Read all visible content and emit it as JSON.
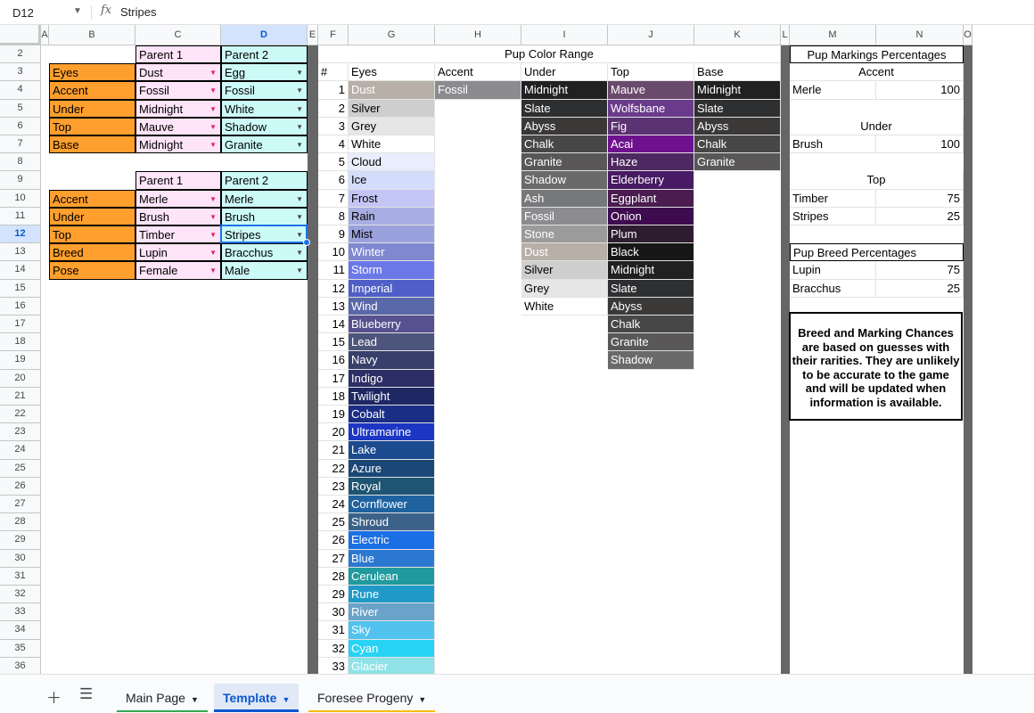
{
  "formula_bar": {
    "cell_ref": "D12",
    "fx": "fx",
    "content": "Stripes"
  },
  "columns": [
    "A",
    "B",
    "C",
    "D",
    "E",
    "F",
    "G",
    "H",
    "I",
    "J",
    "K",
    "L",
    "M",
    "N",
    "O"
  ],
  "rows": [
    "2",
    "3",
    "4",
    "5",
    "6",
    "7",
    "8",
    "9",
    "10",
    "11",
    "12",
    "13",
    "14",
    "15",
    "16",
    "17",
    "18",
    "19",
    "20",
    "21",
    "22",
    "23",
    "24",
    "25",
    "26",
    "27",
    "28",
    "29",
    "30",
    "31",
    "32",
    "33",
    "34",
    "35",
    "36"
  ],
  "selected": {
    "col": "D",
    "row": "12"
  },
  "parents_table": {
    "parent1_header": "Parent 1",
    "parent2_header": "Parent 2",
    "colors": [
      {
        "label": "Eyes",
        "p1": "Dust",
        "p2": "Egg"
      },
      {
        "label": "Accent",
        "p1": "Fossil",
        "p2": "Fossil"
      },
      {
        "label": "Under",
        "p1": "Midnight",
        "p2": "White"
      },
      {
        "label": "Top",
        "p1": "Mauve",
        "p2": "Shadow"
      },
      {
        "label": "Base",
        "p1": "Midnight",
        "p2": "Granite"
      }
    ],
    "markings": [
      {
        "label": "Accent",
        "p1": "Merle",
        "p2": "Merle"
      },
      {
        "label": "Under",
        "p1": "Brush",
        "p2": "Brush"
      },
      {
        "label": "Top",
        "p1": "Timber",
        "p2": "Stripes"
      },
      {
        "label": "Breed",
        "p1": "Lupin",
        "p2": "Bracchus"
      },
      {
        "label": "Pose",
        "p1": "Female",
        "p2": "Male"
      }
    ]
  },
  "pup_color_range": {
    "title": "Pup Color Range",
    "headers": [
      "#",
      "Eyes",
      "Accent",
      "Under",
      "Top",
      "Base"
    ],
    "eyes": [
      {
        "v": "Dust",
        "bg": "#b8b0a8",
        "t": "w"
      },
      {
        "v": "Silver",
        "bg": "#cecece",
        "t": "b"
      },
      {
        "v": "Grey",
        "bg": "#e6e6e6",
        "t": "b"
      },
      {
        "v": "White",
        "bg": "#ffffff",
        "t": "b"
      },
      {
        "v": "Cloud",
        "bg": "#e8eefb",
        "t": "b"
      },
      {
        "v": "Ice",
        "bg": "#d3dcfb",
        "t": "b"
      },
      {
        "v": "Frost",
        "bg": "#c3c6f5",
        "t": "b"
      },
      {
        "v": "Rain",
        "bg": "#a9aee2",
        "t": "b"
      },
      {
        "v": "Mist",
        "bg": "#9ba1dd",
        "t": "b"
      },
      {
        "v": "Winter",
        "bg": "#8088d0",
        "t": "w"
      },
      {
        "v": "Storm",
        "bg": "#6b78e8",
        "t": "w"
      },
      {
        "v": "Imperial",
        "bg": "#4f5fc7",
        "t": "w"
      },
      {
        "v": "Wind",
        "bg": "#5968a8",
        "t": "w"
      },
      {
        "v": "Blueberry",
        "bg": "#57518f",
        "t": "w"
      },
      {
        "v": "Lead",
        "bg": "#4e557c",
        "t": "w"
      },
      {
        "v": "Navy",
        "bg": "#373f6a",
        "t": "w"
      },
      {
        "v": "Indigo",
        "bg": "#2c2e65",
        "t": "w"
      },
      {
        "v": "Twilight",
        "bg": "#1f2863",
        "t": "w"
      },
      {
        "v": "Cobalt",
        "bg": "#1a2e86",
        "t": "w"
      },
      {
        "v": "Ultramarine",
        "bg": "#1d36c4",
        "t": "w"
      },
      {
        "v": "Lake",
        "bg": "#1c4a8f",
        "t": "w"
      },
      {
        "v": "Azure",
        "bg": "#1b4777",
        "t": "w"
      },
      {
        "v": "Royal",
        "bg": "#1e5573",
        "t": "w"
      },
      {
        "v": "Cornflower",
        "bg": "#1e62a0",
        "t": "w"
      },
      {
        "v": "Shroud",
        "bg": "#3c6289",
        "t": "w"
      },
      {
        "v": "Electric",
        "bg": "#1b6fe5",
        "t": "w"
      },
      {
        "v": "Blue",
        "bg": "#2b78d0",
        "t": "w"
      },
      {
        "v": "Cerulean",
        "bg": "#209a9e",
        "t": "w"
      },
      {
        "v": "Rune",
        "bg": "#1f9ac8",
        "t": "w"
      },
      {
        "v": "River",
        "bg": "#69a3c9",
        "t": "w"
      },
      {
        "v": "Sky",
        "bg": "#52c3ef",
        "t": "w"
      },
      {
        "v": "Cyan",
        "bg": "#27d3f5",
        "t": "w"
      },
      {
        "v": "Glacier",
        "bg": "#8fe3e8",
        "t": "w"
      }
    ],
    "accent": [
      {
        "v": "Fossil",
        "bg": "#8c8b90",
        "t": "w"
      }
    ],
    "under": [
      {
        "v": "Midnight",
        "bg": "#212121",
        "t": "w"
      },
      {
        "v": "Slate",
        "bg": "#2e2f31",
        "t": "w"
      },
      {
        "v": "Abyss",
        "bg": "#3b3838",
        "t": "w"
      },
      {
        "v": "Chalk",
        "bg": "#474747",
        "t": "w"
      },
      {
        "v": "Granite",
        "bg": "#595757",
        "t": "w"
      },
      {
        "v": "Shadow",
        "bg": "#6a6a6a",
        "t": "w"
      },
      {
        "v": "Ash",
        "bg": "#77787a",
        "t": "w"
      },
      {
        "v": "Fossil",
        "bg": "#8c8b90",
        "t": "w"
      },
      {
        "v": "Stone",
        "bg": "#9b9b9b",
        "t": "w"
      },
      {
        "v": "Dust",
        "bg": "#b8b0a8",
        "t": "w"
      },
      {
        "v": "Silver",
        "bg": "#cecece",
        "t": "b"
      },
      {
        "v": "Grey",
        "bg": "#e6e6e6",
        "t": "b"
      },
      {
        "v": "White",
        "bg": "#ffffff",
        "t": "b"
      }
    ],
    "top": [
      {
        "v": "Mauve",
        "bg": "#6a4a6c",
        "t": "w"
      },
      {
        "v": "Wolfsbane",
        "bg": "#6b3b8b",
        "t": "w"
      },
      {
        "v": "Fig",
        "bg": "#5c3372",
        "t": "w"
      },
      {
        "v": "Acai",
        "bg": "#6d118e",
        "t": "w"
      },
      {
        "v": "Haze",
        "bg": "#4e2860",
        "t": "w"
      },
      {
        "v": "Elderberry",
        "bg": "#471a63",
        "t": "w"
      },
      {
        "v": "Eggplant",
        "bg": "#4a1c4f",
        "t": "w"
      },
      {
        "v": "Onion",
        "bg": "#3e0b4f",
        "t": "w"
      },
      {
        "v": "Plum",
        "bg": "#2e1c30",
        "t": "w"
      },
      {
        "v": "Black",
        "bg": "#171717",
        "t": "w"
      },
      {
        "v": "Midnight",
        "bg": "#212121",
        "t": "w"
      },
      {
        "v": "Slate",
        "bg": "#2e2f31",
        "t": "w"
      },
      {
        "v": "Abyss",
        "bg": "#3b3838",
        "t": "w"
      },
      {
        "v": "Chalk",
        "bg": "#474747",
        "t": "w"
      },
      {
        "v": "Granite",
        "bg": "#595757",
        "t": "w"
      },
      {
        "v": "Shadow",
        "bg": "#6a6a6a",
        "t": "w"
      }
    ],
    "base": [
      {
        "v": "Midnight",
        "bg": "#212121",
        "t": "w"
      },
      {
        "v": "Slate",
        "bg": "#2e2f31",
        "t": "w"
      },
      {
        "v": "Abyss",
        "bg": "#3b3838",
        "t": "w"
      },
      {
        "v": "Chalk",
        "bg": "#474747",
        "t": "w"
      },
      {
        "v": "Granite",
        "bg": "#595757",
        "t": "w"
      }
    ]
  },
  "markings_pct": {
    "title": "Pup Markings Percentages",
    "accent_title": "Accent",
    "accent": [
      {
        "name": "Merle",
        "pct": "100"
      }
    ],
    "under_title": "Under",
    "under": [
      {
        "name": "Brush",
        "pct": "100"
      }
    ],
    "top_title": "Top",
    "top": [
      {
        "name": "Timber",
        "pct": "75"
      },
      {
        "name": "Stripes",
        "pct": "25"
      }
    ],
    "breed_title": "Pup Breed Percentages",
    "breed": [
      {
        "name": "Lupin",
        "pct": "75"
      },
      {
        "name": "Bracchus",
        "pct": "25"
      }
    ]
  },
  "note": "Breed and Marking Chances are based on guesses with their rarities. They are unlikely to be accurate to the game and will be updated when information is available.",
  "tabs": [
    {
      "label": "Main Page",
      "line": "#34a853"
    },
    {
      "label": "Template",
      "line": "#0b57d0"
    },
    {
      "label": "Foresee Progeny",
      "line": "#fbbc04"
    }
  ],
  "colors": {
    "orange": "#ff9f2e",
    "pink": "#fde4f8",
    "cyan": "#ccfaf7",
    "separator": "#666666",
    "selection": "#1a73e8"
  }
}
